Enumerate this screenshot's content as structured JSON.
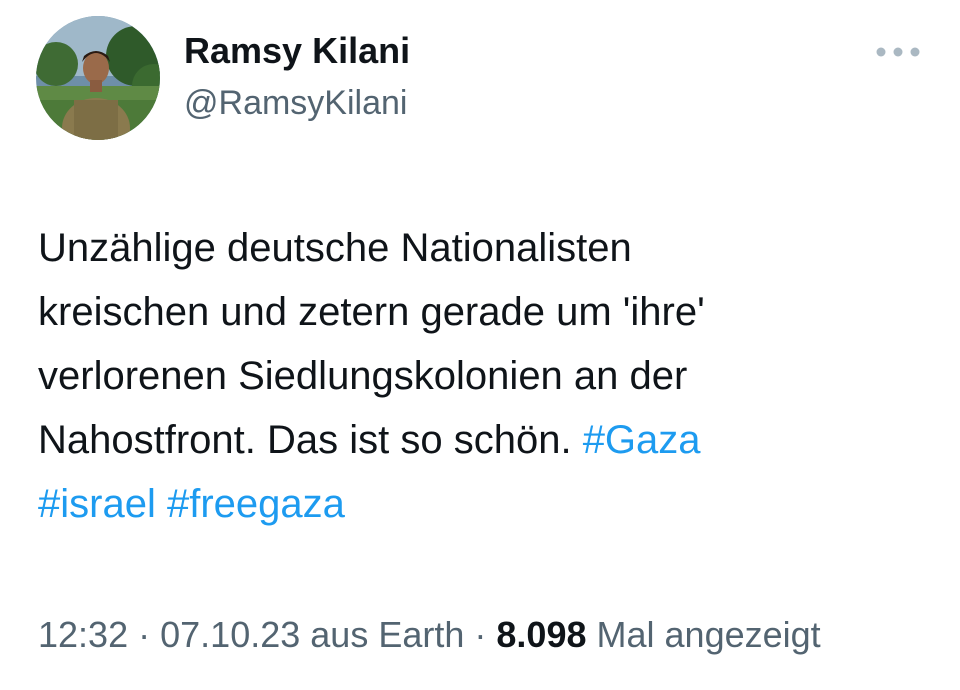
{
  "author": {
    "name": "Ramsy Kilani",
    "handle": "@RamsyKilani"
  },
  "tweet": {
    "line1": "Unzählige deutsche Nationalisten",
    "line2": "kreischen und zetern gerade um 'ihre'",
    "line3": "verlorenen Siedlungskolonien an der",
    "line4_text": "Nahostfront. Das ist so schön. ",
    "hashtags": [
      "#Gaza",
      "#israel",
      "#freegaza"
    ]
  },
  "meta": {
    "time": "12:32",
    "date": "07.10.23",
    "location": "aus Earth",
    "views_count": "8.098",
    "views_label": "Mal angezeigt",
    "separator": "·"
  },
  "colors": {
    "hashtag": "#1d9bf0",
    "secondary_text": "#536471",
    "primary_text": "#0f1419"
  },
  "icons": {
    "more": "more-horizontal-icon"
  }
}
